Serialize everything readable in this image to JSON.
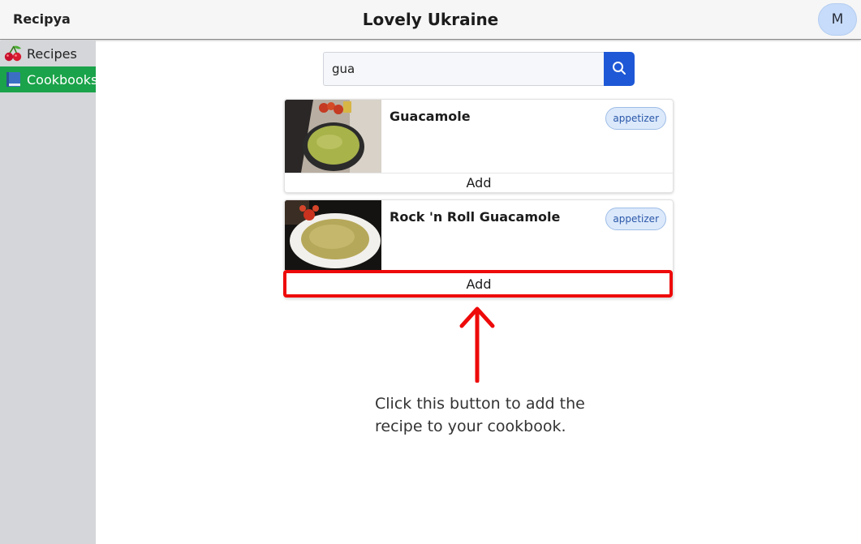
{
  "header": {
    "brand": "Recipya",
    "title": "Lovely Ukraine",
    "avatar_initial": "M"
  },
  "sidebar": {
    "items": [
      {
        "label": "Recipes",
        "icon": "cherries-icon",
        "active": false
      },
      {
        "label": "Cookbooks",
        "icon": "blue-book-icon",
        "active": true
      }
    ]
  },
  "search": {
    "value": "gua",
    "button_icon": "search-icon"
  },
  "results": [
    {
      "name": "Guacamole",
      "tag": "appetizer",
      "add_label": "Add"
    },
    {
      "name": "Rock 'n Roll Guacamole",
      "tag": "appetizer",
      "add_label": "Add"
    }
  ],
  "annotation": {
    "text": "Click this button to add the recipe to your cookbook.",
    "color": "#ee0a0a"
  },
  "colors": {
    "active_nav": "#1aa34a",
    "search_button": "#1e58d6",
    "sidebar_bg": "#d4d6d9",
    "avatar_bg": "#c7dcfa"
  }
}
